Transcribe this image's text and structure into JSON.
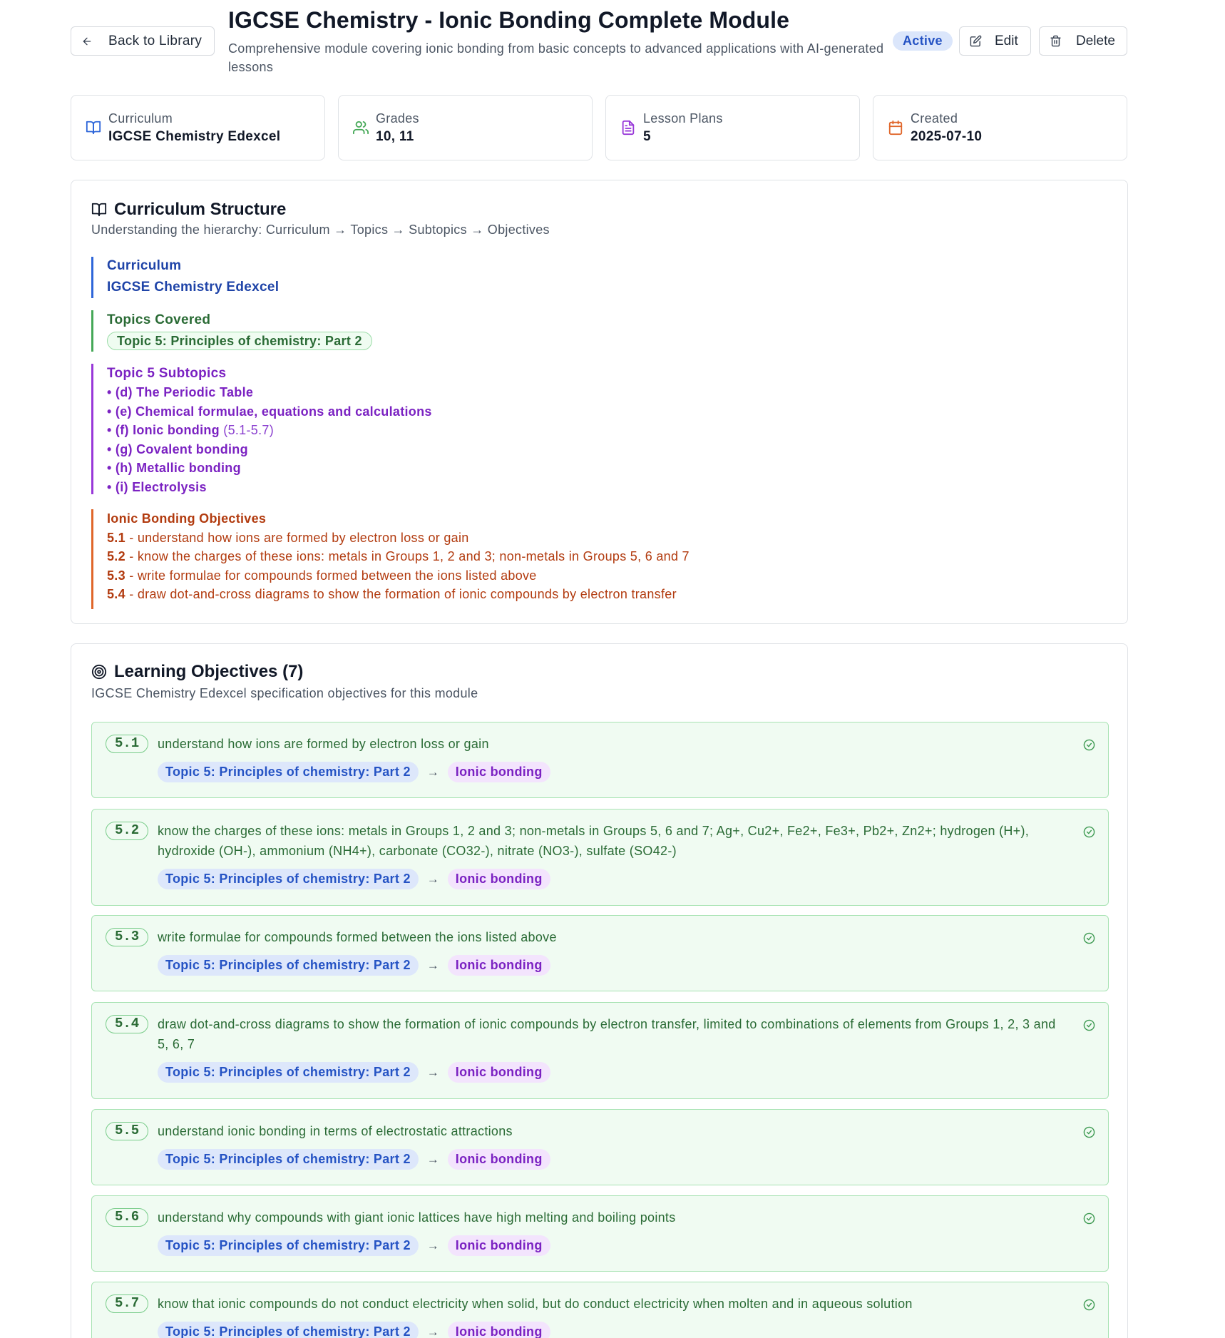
{
  "header": {
    "back_label": "Back to Library",
    "title": "IGCSE Chemistry - Ionic Bonding Complete Module",
    "description": "Comprehensive module covering ionic bonding from basic concepts to advanced applications with AI-generated lessons",
    "status": "Active",
    "edit_label": "Edit",
    "delete_label": "Delete"
  },
  "stats": [
    {
      "label": "Curriculum",
      "value": "IGCSE Chemistry Edexcel",
      "icon": "book-open-icon",
      "color": "#2e66d9"
    },
    {
      "label": "Grades",
      "value": "10, 11",
      "icon": "users-icon",
      "color": "#45a857"
    },
    {
      "label": "Lesson Plans",
      "value": "5",
      "icon": "file-text-icon",
      "color": "#9838d8"
    },
    {
      "label": "Created",
      "value": "2025-07-10",
      "icon": "calendar-icon",
      "color": "#e0662a"
    }
  ],
  "structure": {
    "title": "Curriculum Structure",
    "subtitle": "Understanding the hierarchy: Curriculum → Topics → Subtopics → Objectives",
    "curriculum_label": "Curriculum",
    "curriculum_value": "IGCSE Chemistry Edexcel",
    "topics_label": "Topics Covered",
    "topic": "Topic 5: Principles of chemistry: Part 2",
    "subtopics_label": "Topic 5 Subtopics",
    "subtopics": [
      {
        "text": "• (d) The Periodic Table",
        "ref": ""
      },
      {
        "text": "• (e) Chemical formulae, equations and calculations",
        "ref": ""
      },
      {
        "text": "• (f) Ionic bonding",
        "ref": " (5.1-5.7)"
      },
      {
        "text": "• (g) Covalent bonding",
        "ref": ""
      },
      {
        "text": "• (h) Metallic bonding",
        "ref": ""
      },
      {
        "text": "• (i) Electrolysis",
        "ref": ""
      }
    ],
    "objectives_label": "Ionic Bonding Objectives",
    "objectives": [
      {
        "code": "5.1",
        "text": " - understand how ions are formed by electron loss or gain"
      },
      {
        "code": "5.2",
        "text": " - know the charges of these ions: metals in Groups 1, 2 and 3; non-metals in Groups 5, 6 and 7"
      },
      {
        "code": "5.3",
        "text": " - write formulae for compounds formed between the ions listed above"
      },
      {
        "code": "5.4",
        "text": " - draw dot-and-cross diagrams to show the formation of ionic compounds by electron transfer"
      }
    ]
  },
  "objectives_panel": {
    "title": "Learning Objectives (7)",
    "subtitle": "IGCSE Chemistry Edexcel specification objectives for this module",
    "arrow": "→",
    "items": [
      {
        "code": "5.1",
        "text": "understand how ions are formed by electron loss or gain",
        "topic": "Topic 5: Principles of chemistry: Part 2",
        "subtopic": "Ionic bonding"
      },
      {
        "code": "5.2",
        "text": "know the charges of these ions: metals in Groups 1, 2 and 3; non-metals in Groups 5, 6 and 7; Ag+, Cu2+, Fe2+, Fe3+, Pb2+, Zn2+; hydrogen (H+), hydroxide (OH-), ammonium (NH4+), carbonate (CO32-), nitrate (NO3-), sulfate (SO42-)",
        "topic": "Topic 5: Principles of chemistry: Part 2",
        "subtopic": "Ionic bonding"
      },
      {
        "code": "5.3",
        "text": "write formulae for compounds formed between the ions listed above",
        "topic": "Topic 5: Principles of chemistry: Part 2",
        "subtopic": "Ionic bonding"
      },
      {
        "code": "5.4",
        "text": "draw dot-and-cross diagrams to show the formation of ionic compounds by electron transfer, limited to combinations of elements from Groups 1, 2, 3 and 5, 6, 7",
        "topic": "Topic 5: Principles of chemistry: Part 2",
        "subtopic": "Ionic bonding"
      },
      {
        "code": "5.5",
        "text": "understand ionic bonding in terms of electrostatic attractions",
        "topic": "Topic 5: Principles of chemistry: Part 2",
        "subtopic": "Ionic bonding"
      },
      {
        "code": "5.6",
        "text": "understand why compounds with giant ionic lattices have high melting and boiling points",
        "topic": "Topic 5: Principles of chemistry: Part 2",
        "subtopic": "Ionic bonding"
      },
      {
        "code": "5.7",
        "text": "know that ionic compounds do not conduct electricity when solid, but do conduct electricity when molten and in aqueous solution",
        "topic": "Topic 5: Principles of chemistry: Part 2",
        "subtopic": "Ionic bonding"
      }
    ]
  }
}
